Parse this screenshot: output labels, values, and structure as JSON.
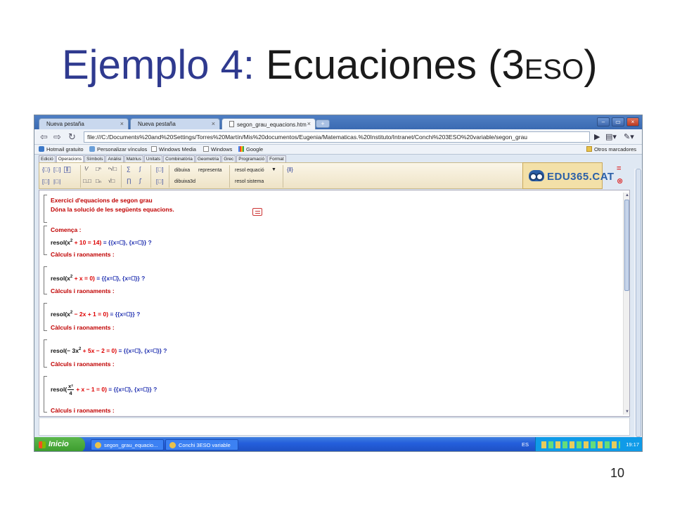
{
  "slide": {
    "title_part1": "Ejemplo 4: ",
    "title_part2": "Ecuaciones (3",
    "title_part3": "ESO",
    "title_part4": ")",
    "page_number": "10"
  },
  "browser": {
    "tabs": [
      {
        "label": "Nueva pestaña",
        "active": false
      },
      {
        "label": "Nueva pestaña",
        "active": false
      },
      {
        "label": "segon_grau_equacions.htm",
        "active": true
      }
    ],
    "new_tab": "+",
    "window_controls": {
      "minimize": "–",
      "maximize": "▭",
      "close": "×"
    },
    "url": "file:///C:/Documents%20and%20Settings/Torres%20Martín/Mis%20documentos/Eugenia/Matematicas.%20Instituto/Intranet/Conchi%203ESO%20variable/segon_grau",
    "bookmarks": [
      {
        "label": "Hotmail gratuito",
        "icon": "mail-icon"
      },
      {
        "label": "Personalizar vínculos",
        "icon": "star-icon"
      },
      {
        "label": "Windows Media",
        "icon": "page-icon"
      },
      {
        "label": "Windows",
        "icon": "page-icon"
      },
      {
        "label": "Google",
        "icon": "google-icon"
      }
    ],
    "other_bookmarks": "Otros marcadores"
  },
  "wiris": {
    "menu": [
      "Edició",
      "Operacions",
      "Símbols",
      "Anàlisi",
      "Matrius",
      "Unitats",
      "Combinatòria",
      "Geometria",
      "Grec",
      "Programació",
      "Format"
    ],
    "active_menu": "Operacions",
    "commands": {
      "dibuixa": "dibuixa",
      "representa": "representa",
      "resol_equacio": "resol equació",
      "dibuixa3d": "dibuixa3d",
      "resol_sistema": "resol sistema"
    },
    "logo": "EDU365.CAT"
  },
  "document": {
    "heading1": "Exercici d'equacions de segon grau",
    "heading2": "Dóna la solució de les següents equacions.",
    "start_label": "Comença :",
    "reasoning_label": "Càlculs i raonaments :",
    "equations": [
      {
        "prefix": "resol(x",
        "exp": "2",
        "rest": " + 10 = 14)",
        "answer": " ≡ {{x=⎕}, {x=⎕}} ?"
      },
      {
        "prefix": "resol(x",
        "exp": "2",
        "rest": " + x = 0)",
        "answer": " ≡ {{x=⎕}, {x=⎕}} ?"
      },
      {
        "prefix": "resol(x",
        "exp": "2",
        "rest": " − 2x + 1 = 0)",
        "answer": " ≡ {{x=⎕}} ?"
      },
      {
        "prefix": "resol(− 3x",
        "exp": "2",
        "rest": " + 5x − 2 = 0)",
        "answer": " ≡ {{x=⎕}, {x=⎕}} ?"
      },
      {
        "prefix": "resol(",
        "frac_num": "x²",
        "frac_den": "4",
        "rest": " + x − 1 = 0)",
        "answer": " ≡ {{x=⎕}, {x=⎕}} ?"
      }
    ]
  },
  "taskbar": {
    "start": "Inicio",
    "tasks": [
      "segon_grau_equacio...",
      "Conchi 3ESO variable"
    ],
    "language": "ES",
    "clock": "19:17"
  }
}
